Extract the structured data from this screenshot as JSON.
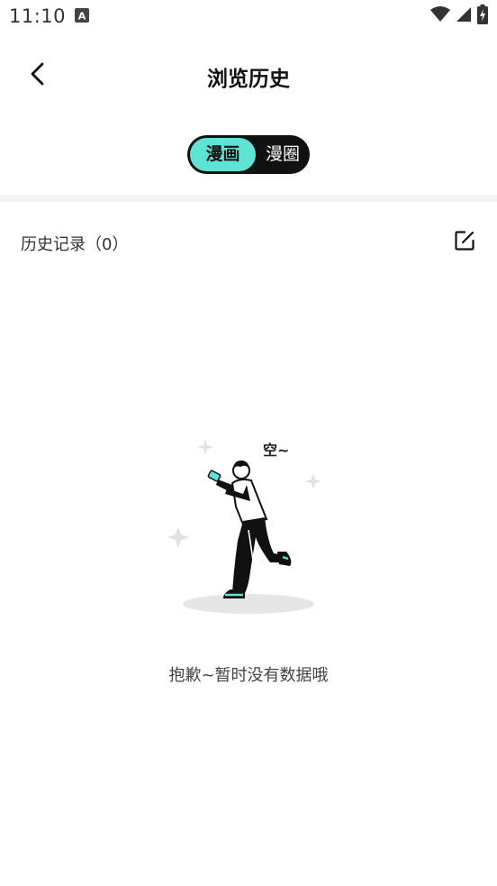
{
  "status_bar": {
    "time": "11:10",
    "notification_icon": "a-letter-icon",
    "icons": [
      "wifi-icon",
      "cellular-signal-icon",
      "battery-charging-icon"
    ]
  },
  "header": {
    "title": "浏览历史",
    "back_icon": "chevron-left-icon"
  },
  "tabs": {
    "items": [
      {
        "label": "漫画",
        "active": true
      },
      {
        "label": "漫圈",
        "active": false
      }
    ],
    "active_color": "#5ee3d5",
    "background_color": "#111111"
  },
  "history": {
    "label": "历史记录（0）",
    "edit_icon": "edit-icon"
  },
  "empty_state": {
    "illustration_text": "空~",
    "message": "抱歉~暂时没有数据哦"
  }
}
